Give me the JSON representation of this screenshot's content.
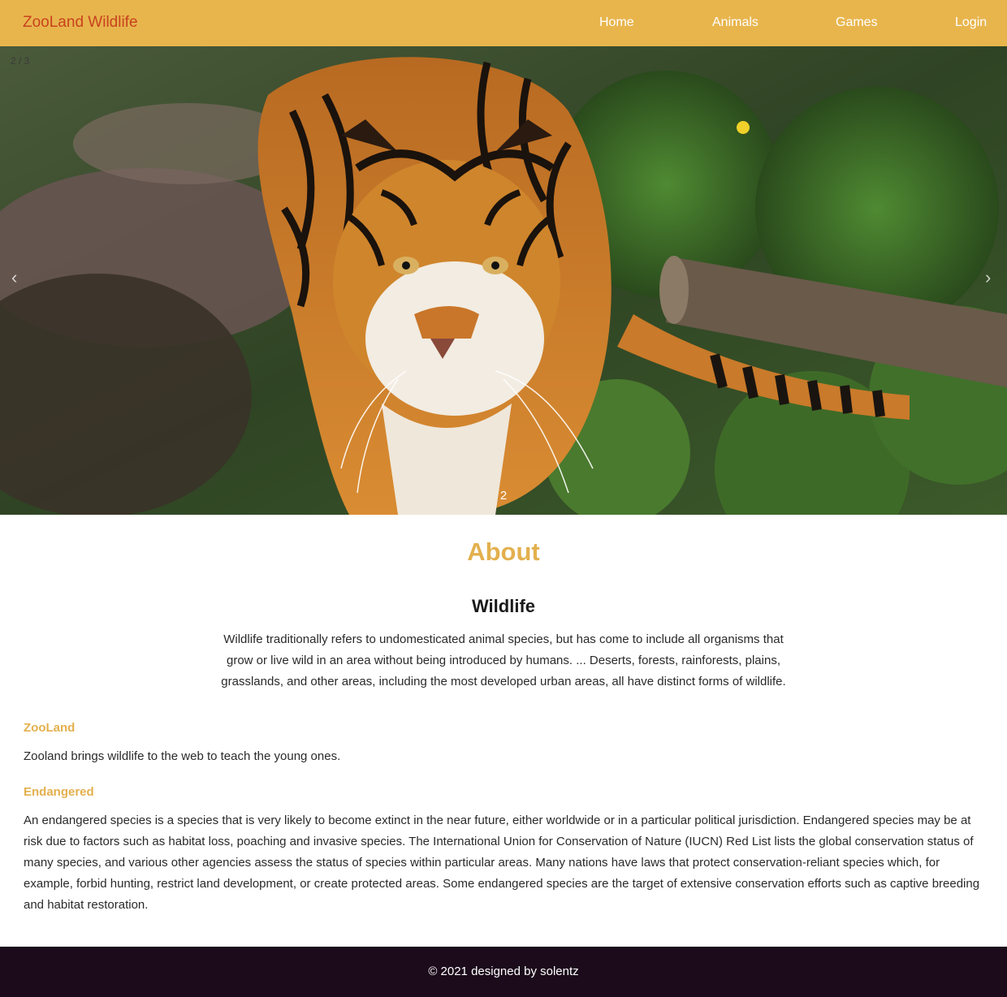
{
  "navbar": {
    "brand": "ZooLand Wildlife",
    "links": [
      "Home",
      "Animals",
      "Games",
      "Login"
    ]
  },
  "slideshow": {
    "counter": "2 / 3",
    "caption": "2",
    "prev_glyph": "‹",
    "next_glyph": "›",
    "image_subject": "tiger-in-forest"
  },
  "about": {
    "title": "About",
    "subtitle": "Wildlife",
    "intro": "Wildlife traditionally refers to undomesticated animal species, but has come to include all organisms that grow or live wild in an area without being introduced by humans. ... Deserts, forests, rainforests, plains, grasslands, and other areas, including the most developed urban areas, all have distinct forms of wildlife."
  },
  "sections": {
    "zooland": {
      "title": "ZooLand",
      "text": "Zooland brings wildlife to the web to teach the young ones."
    },
    "endangered": {
      "title": "Endangered",
      "text": "An endangered species is a species that is very likely to become extinct in the near future, either worldwide or in a particular political jurisdiction. Endangered species may be at risk due to factors such as habitat loss, poaching and invasive species. The International Union for Conservation of Nature (IUCN) Red List lists the global conservation status of many species, and various other agencies assess the status of species within particular areas. Many nations have laws that protect conservation-reliant species which, for example, forbid hunting, restrict land development, or create protected areas. Some endangered species are the target of extensive conservation efforts such as captive breeding and habitat restoration."
    }
  },
  "footer": {
    "text": "© 2021 designed by solentz"
  },
  "colors": {
    "navbar_bg": "#e8b54d",
    "brand": "#c8421e",
    "accent": "#e3b04e",
    "footer_bg": "#1b0b1b"
  }
}
